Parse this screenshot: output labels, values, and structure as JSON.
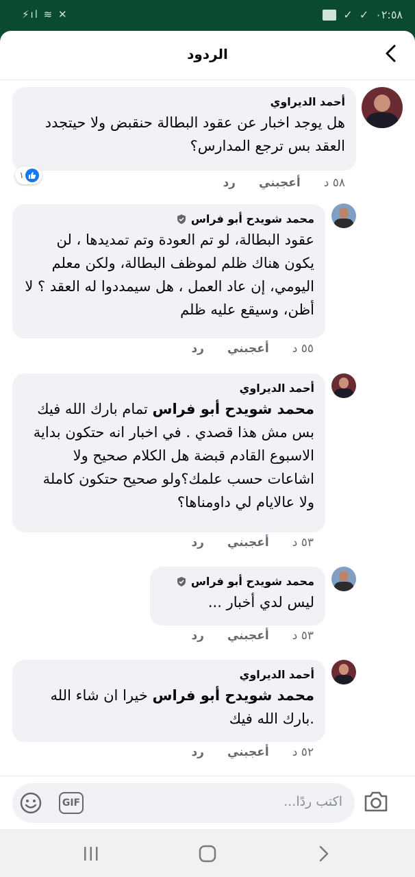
{
  "status_bar": {
    "time": "٠٢:٥٨",
    "left_icons": "⚡ıl ≋ ✕"
  },
  "header": {
    "title": "الردود",
    "back_icon": "chevron-left-icon"
  },
  "comments": [
    {
      "author": "أحمد الديراوي",
      "verified": false,
      "mention": "",
      "text": "هل يوجد اخبار عن عقود البطالة حنقبض ولا حيتجدد العقد بس ترجع المدارس؟",
      "time": "٥٨ د",
      "like_label": "أعجبني",
      "reply_label": "رد",
      "reaction_count": "١"
    },
    {
      "author": "محمد شويدح أبو فراس",
      "verified": true,
      "mention": "",
      "text": "عقود البطالة، لو تم العودة وتم تمديدها ، لن يكون هناك ظلم لموظف البطالة، ولكن معلم اليومي، إن عاد العمل ، هل سيمددوا له العقد ؟ لا أظن، وسيقع عليه ظلم",
      "time": "٥٥ د",
      "like_label": "أعجبني",
      "reply_label": "رد"
    },
    {
      "author": "أحمد الديراوي",
      "verified": false,
      "mention": "محمد شويدح أبو فراس",
      "text": "تمام بارك الله فيك بس مش هذا قصدي . في اخبار انه حتكون بداية الاسبوع القادم قبضة هل الكلام صحيح ولا اشاعات حسب علمك؟ولو صحيح حتكون كاملة ولا عالايام لي داومناها؟",
      "time": "٥٣ د",
      "like_label": "أعجبني",
      "reply_label": "رد"
    },
    {
      "author": "محمد شويدح أبو فراس",
      "verified": true,
      "mention": "",
      "text": "ليس لدي أخبار ...",
      "time": "٥٣ د",
      "like_label": "أعجبني",
      "reply_label": "رد"
    },
    {
      "author": "أحمد الديراوي",
      "verified": false,
      "mention": "محمد شويدح أبو فراس",
      "text": "خيرا ان شاء الله .بارك الله فيك",
      "time": "٥٢ د",
      "like_label": "أعجبني",
      "reply_label": "رد"
    }
  ],
  "composer": {
    "placeholder": "اكتب ردًا...",
    "gif_label": "GIF",
    "emoji_icon": "smiley-icon",
    "camera_icon": "camera-icon"
  },
  "nav_bar": {
    "icons": [
      "recent-apps-icon",
      "home-icon",
      "back-icon"
    ]
  }
}
